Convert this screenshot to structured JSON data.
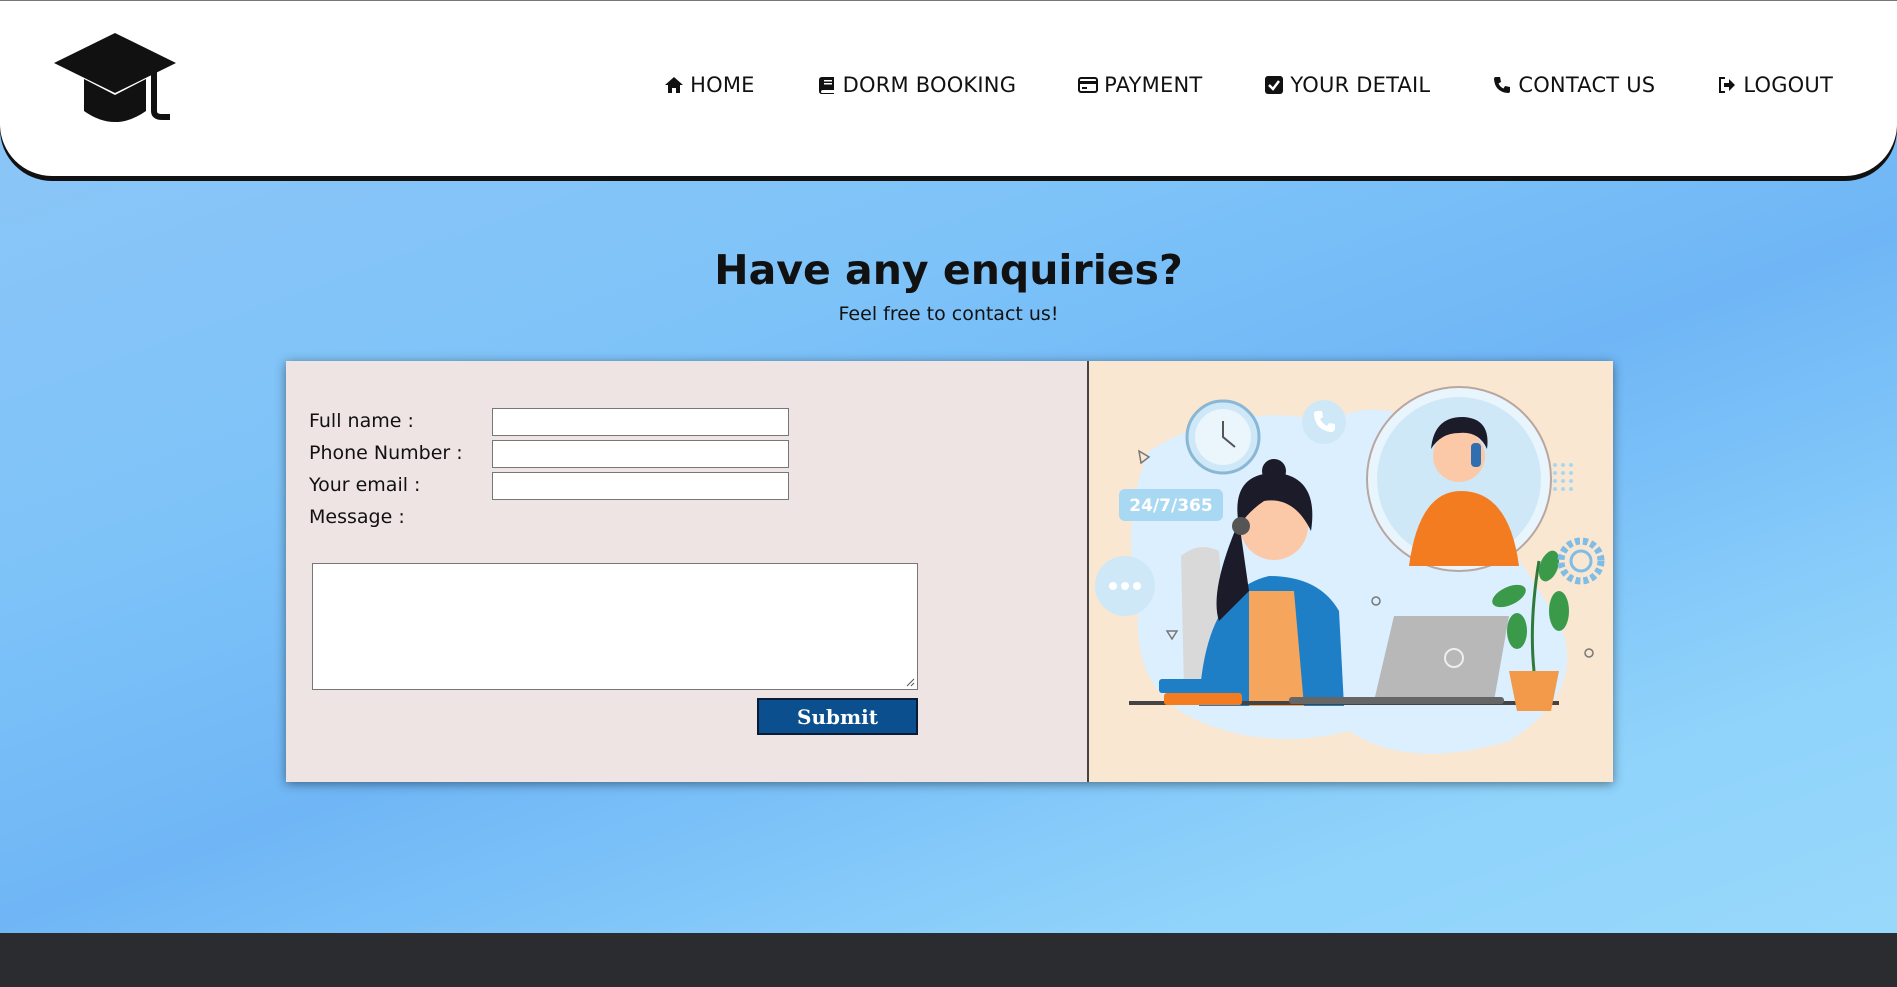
{
  "nav": {
    "logo_icon": "graduation-cap-icon",
    "items": [
      {
        "label": "HOME",
        "icon": "home-icon"
      },
      {
        "label": "DORM BOOKING",
        "icon": "book-icon"
      },
      {
        "label": "PAYMENT",
        "icon": "credit-card-icon"
      },
      {
        "label": "YOUR DETAIL",
        "icon": "check-square-icon"
      },
      {
        "label": "CONTACT US",
        "icon": "phone-icon"
      },
      {
        "label": "LOGOUT",
        "icon": "logout-icon"
      }
    ]
  },
  "hero": {
    "title": "Have any enquiries?",
    "subtitle": "Feel free to contact us!"
  },
  "form": {
    "fullname_label": "Full name :",
    "fullname_value": "",
    "phone_label": "Phone Number :",
    "phone_value": "",
    "email_label": "Your email :",
    "email_value": "",
    "message_label": "Message :",
    "message_value": "",
    "submit_label": "Submit"
  },
  "illustration": {
    "badge_text": "24/7/365"
  },
  "colors": {
    "submit_bg": "#0c4f8f",
    "form_bg": "#efe4e4",
    "illustration_bg": "#f9e7d2",
    "footer_bg": "#2b2c30"
  }
}
